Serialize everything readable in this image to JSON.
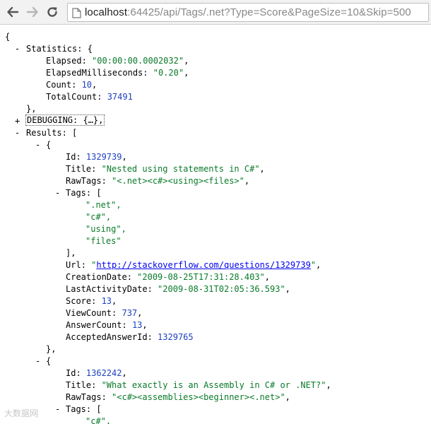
{
  "browser": {
    "url_host": "localhost",
    "url_rest": ":64425/api/Tags/.net?Type=Score&PageSize=10&Skip=500"
  },
  "json": {
    "open_brace": "{",
    "stats_key": "Statistics",
    "stats_open": "{",
    "stats_close": "},",
    "elapsed_key": "Elapsed",
    "elapsed_value": "\"00:00:00.0002032\"",
    "elapsed_ms_key": "ElapsedMilliseconds",
    "elapsed_ms_value": "\"0.20\"",
    "count_key": "Count",
    "count_value": "10",
    "total_key": "TotalCount",
    "total_value": "37491",
    "debugging_key": "DEBUGGING",
    "debugging_value": "{…}",
    "results_key": "Results",
    "results_open": "[",
    "toggle_minus": "-",
    "toggle_plus": "+",
    "item_open": "{",
    "item_close": "},",
    "tags_open": "[",
    "tags_close": "],",
    "items": [
      {
        "id_key": "Id",
        "id_value": "1329739",
        "title_key": "Title",
        "title_value": "\"Nested using statements in C#\"",
        "rawtags_key": "RawTags",
        "rawtags_value": "\"<.net><c#><using><files>\"",
        "tags_key": "Tags",
        "tags": [
          "\".net\"",
          "\"c#\"",
          "\"using\"",
          "\"files\""
        ],
        "url_key": "Url",
        "url_value": "http://stackoverflow.com/questions/1329739",
        "creation_key": "CreationDate",
        "creation_value": "\"2009-08-25T17:31:28.403\"",
        "lastact_key": "LastActivityDate",
        "lastact_value": "\"2009-08-31T02:05:36.593\"",
        "score_key": "Score",
        "score_value": "13",
        "views_key": "ViewCount",
        "views_value": "737",
        "answers_key": "AnswerCount",
        "answers_value": "13",
        "accepted_key": "AcceptedAnswerId",
        "accepted_value": "1329765"
      },
      {
        "id_key": "Id",
        "id_value": "1362242",
        "title_key": "Title",
        "title_value": "\"What exactly is an Assembly in C# or .NET?\"",
        "rawtags_key": "RawTags",
        "rawtags_value": "\"<c#><assemblies><beginner><.net>\"",
        "tags_key": "Tags",
        "tags": [
          "\"c#\""
        ]
      }
    ]
  },
  "watermark": "大数据网"
}
